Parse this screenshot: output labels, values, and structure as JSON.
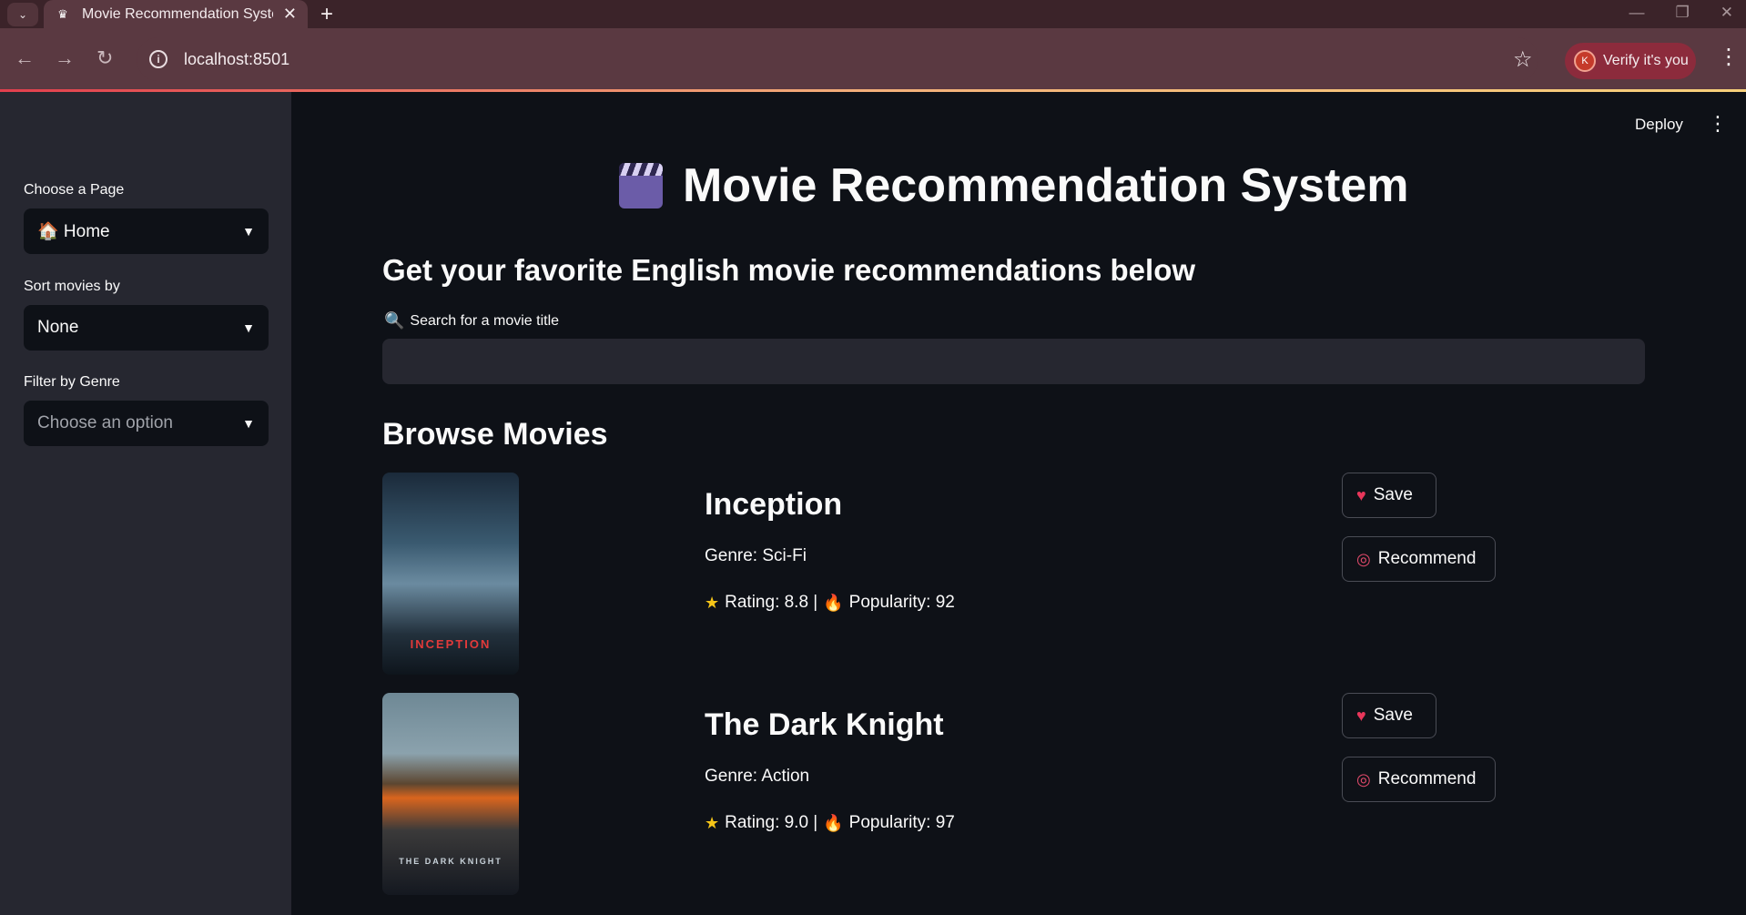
{
  "browser": {
    "tab_title": "Movie Recommendation System",
    "url": "localhost:8501",
    "verify_label": "Verify it's you",
    "avatar_initial": "K"
  },
  "sidebar": {
    "page_label": "Choose a Page",
    "page_value": "🏠 Home",
    "sort_label": "Sort movies by",
    "sort_value": "None",
    "genre_label": "Filter by Genre",
    "genre_placeholder": "Choose an option"
  },
  "header": {
    "deploy_label": "Deploy",
    "title": "Movie Recommendation System",
    "subtitle": "Get your favorite English movie recommendations below"
  },
  "search": {
    "label": "Search for a movie title",
    "value": ""
  },
  "browse": {
    "heading": "Browse Movies",
    "movies": [
      {
        "title": "Inception",
        "genre": "Genre: Sci-Fi",
        "rating": "Rating: 8.8 |",
        "popularity": "Popularity: 92",
        "poster_text": "INCEPTION",
        "save_label": "Save",
        "recommend_label": "Recommend"
      },
      {
        "title": "The Dark Knight",
        "genre": "Genre: Action",
        "rating": "Rating: 9.0 |",
        "popularity": "Popularity: 97",
        "poster_text": "THE DARK KNIGHT",
        "save_label": "Save",
        "recommend_label": "Recommend"
      }
    ]
  }
}
